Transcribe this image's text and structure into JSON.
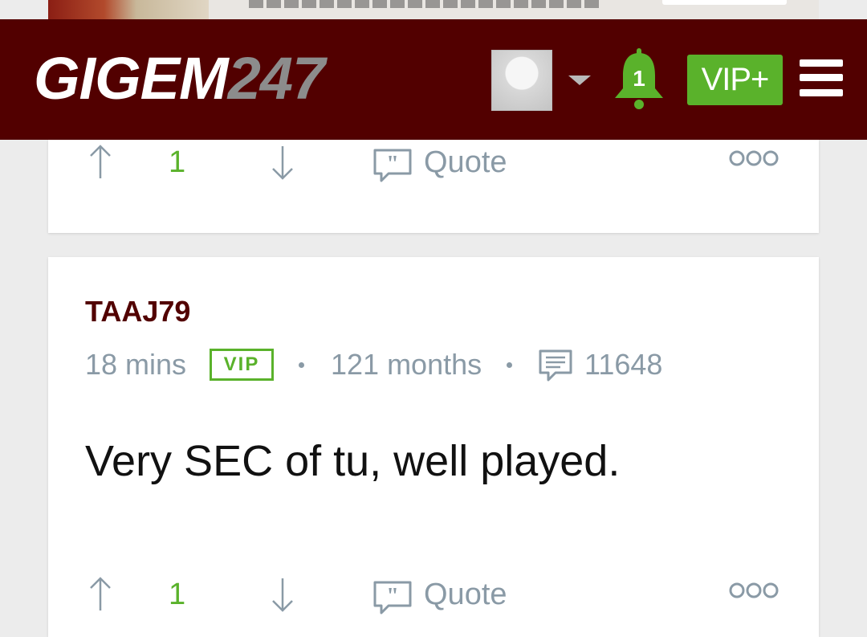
{
  "header": {
    "logo_main": "GIGEM",
    "logo_num": "247",
    "notification_count": "1",
    "vip_plus_label": "VIP+"
  },
  "colors": {
    "brand_maroon": "#520000",
    "accent_green": "#5ab22b",
    "meta_gray": "#8a9aa6"
  },
  "posts": [
    {
      "vote_count": "1",
      "quote_label": "Quote"
    },
    {
      "username": "TAAJ79",
      "time": "18 mins",
      "badge": "VIP",
      "tenure": "121 months",
      "post_count": "11648",
      "body": "Very SEC of tu, well played.",
      "vote_count": "1",
      "quote_label": "Quote"
    }
  ],
  "icons": [
    "user-avatar",
    "caret-down-icon",
    "bell-icon",
    "menu-icon",
    "arrow-up-icon",
    "arrow-down-icon",
    "quote-icon",
    "more-icon",
    "comment-icon"
  ]
}
